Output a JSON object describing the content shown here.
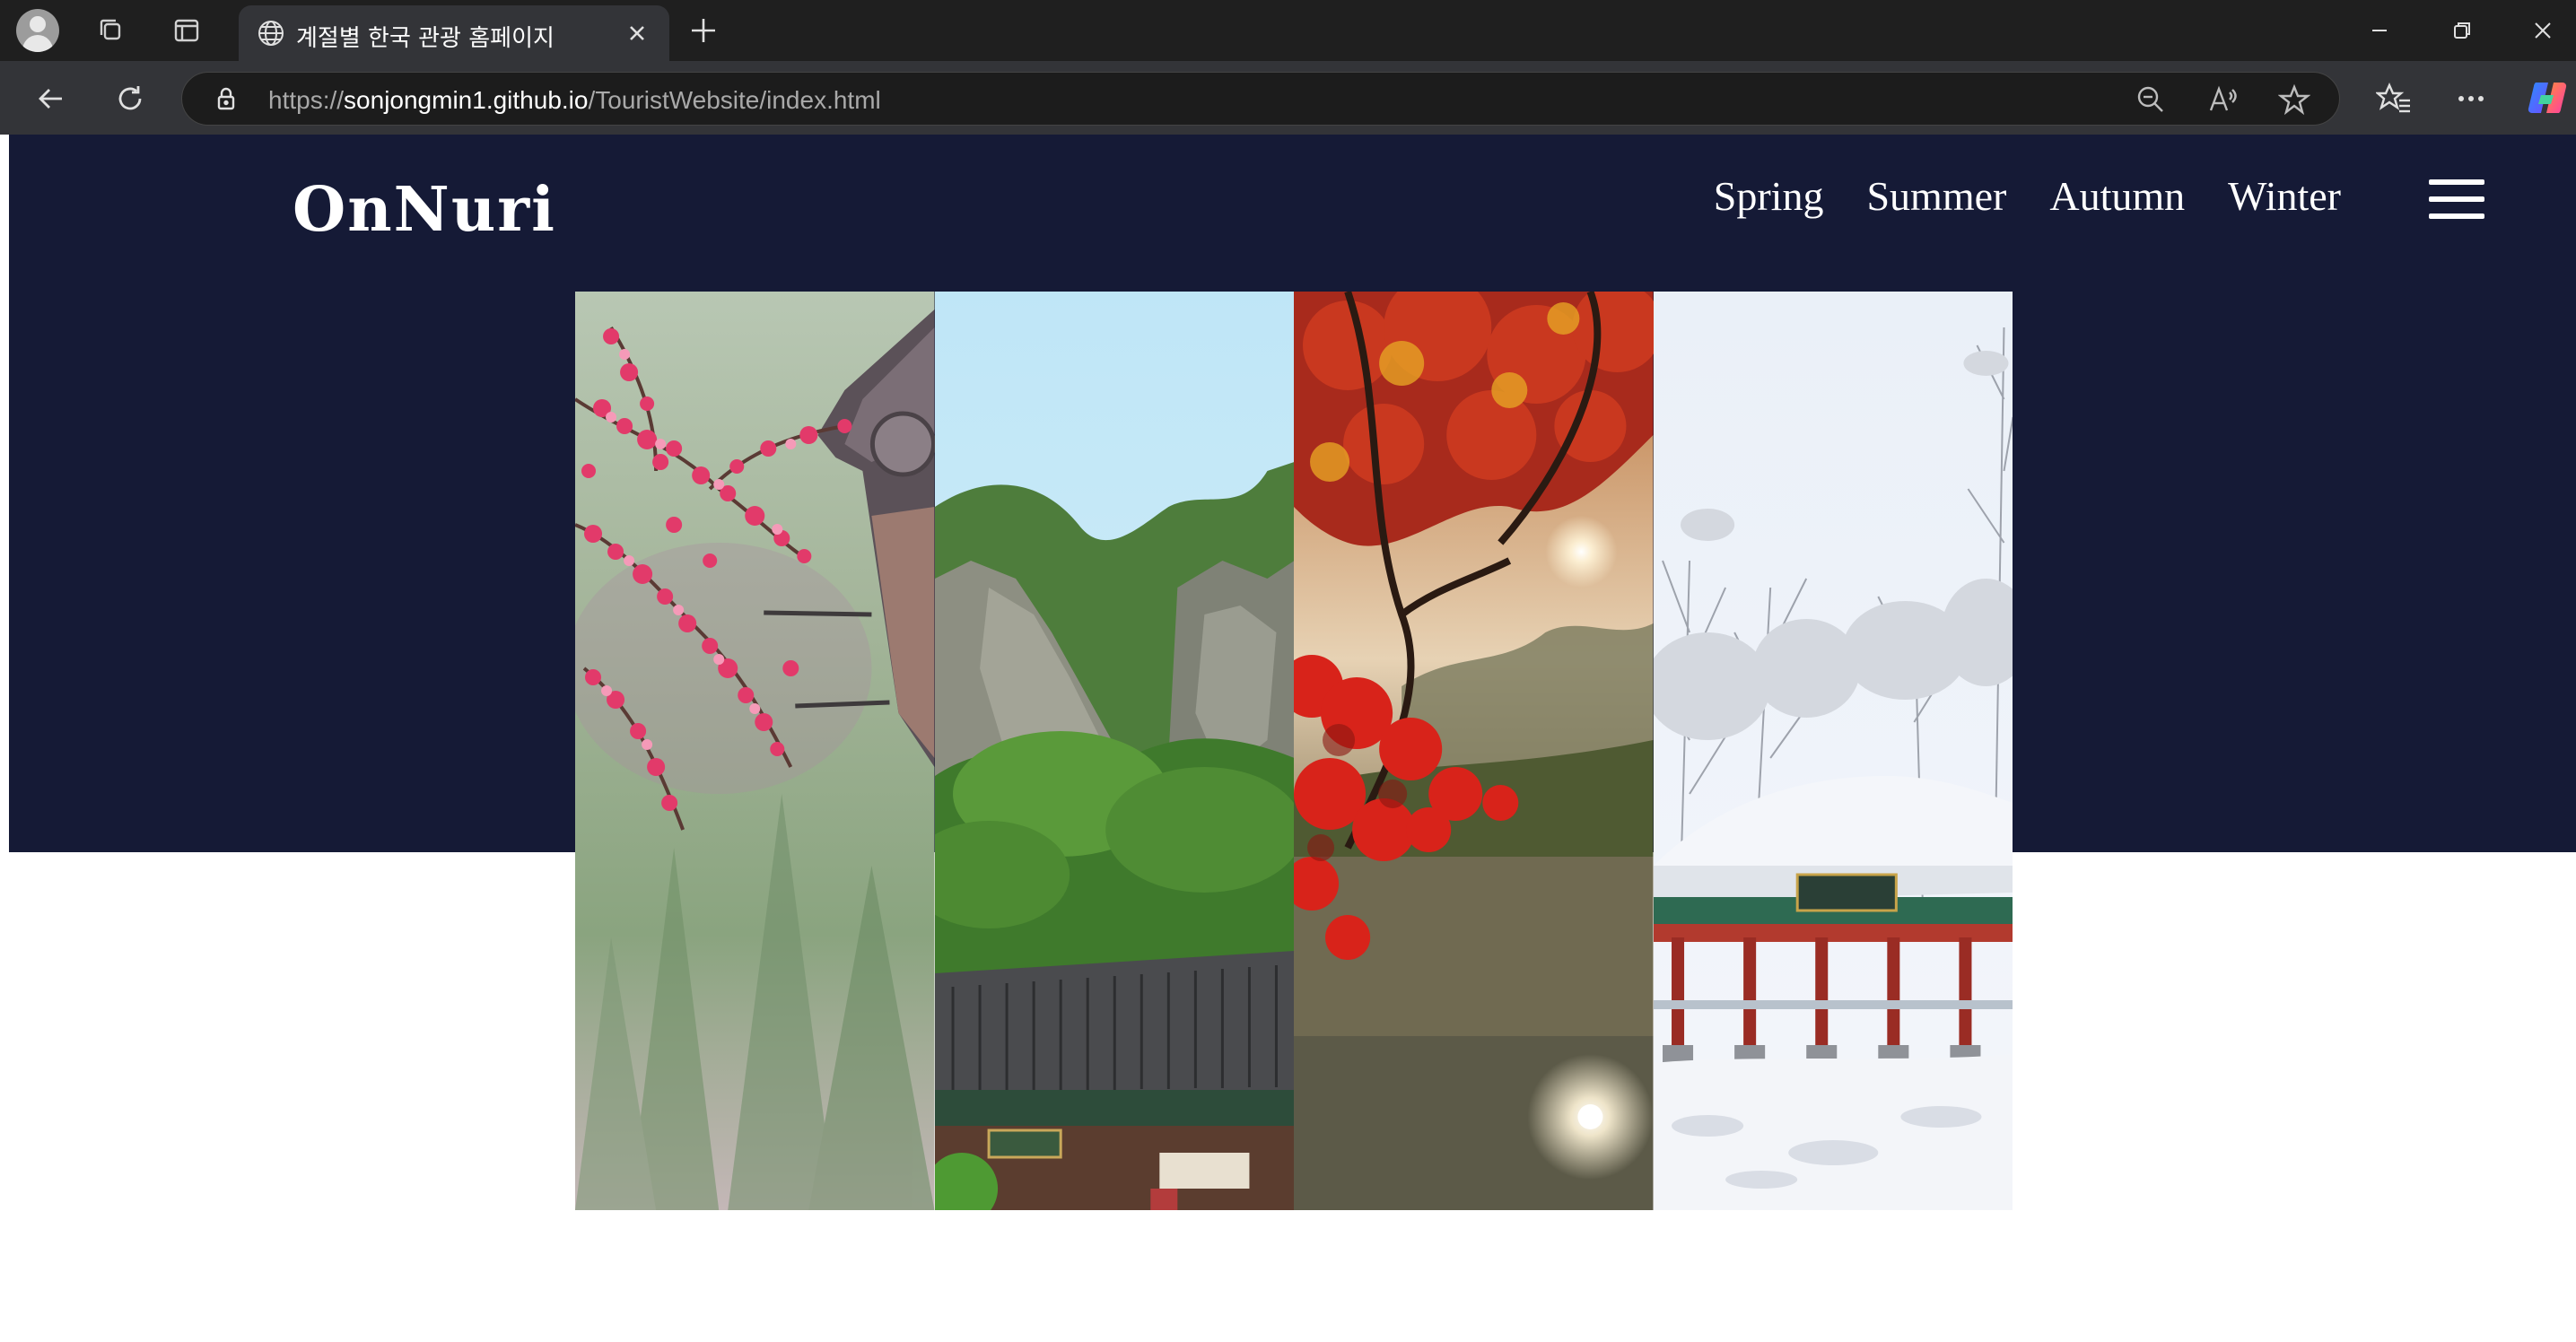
{
  "browser": {
    "tab_title": "계절별 한국 관광 홈페이지",
    "url_scheme": "https://",
    "url_host": "sonjongmin1.github.io",
    "url_path": "/TouristWebsite/index.html"
  },
  "site": {
    "logo": "OnNuri",
    "nav": [
      "Spring",
      "Summer",
      "Autumn",
      "Winter"
    ]
  },
  "panels": [
    {
      "season": "spring",
      "icon": "plum-blossom-roof-image"
    },
    {
      "season": "summer",
      "icon": "mountain-temple-image"
    },
    {
      "season": "autumn",
      "icon": "red-maple-lake-image"
    },
    {
      "season": "winter",
      "icon": "snow-pavilion-image"
    }
  ],
  "colors": {
    "hero_bg": "#151a36",
    "chrome_bg": "#1f1f1f",
    "toolbar_bg": "#333438"
  }
}
